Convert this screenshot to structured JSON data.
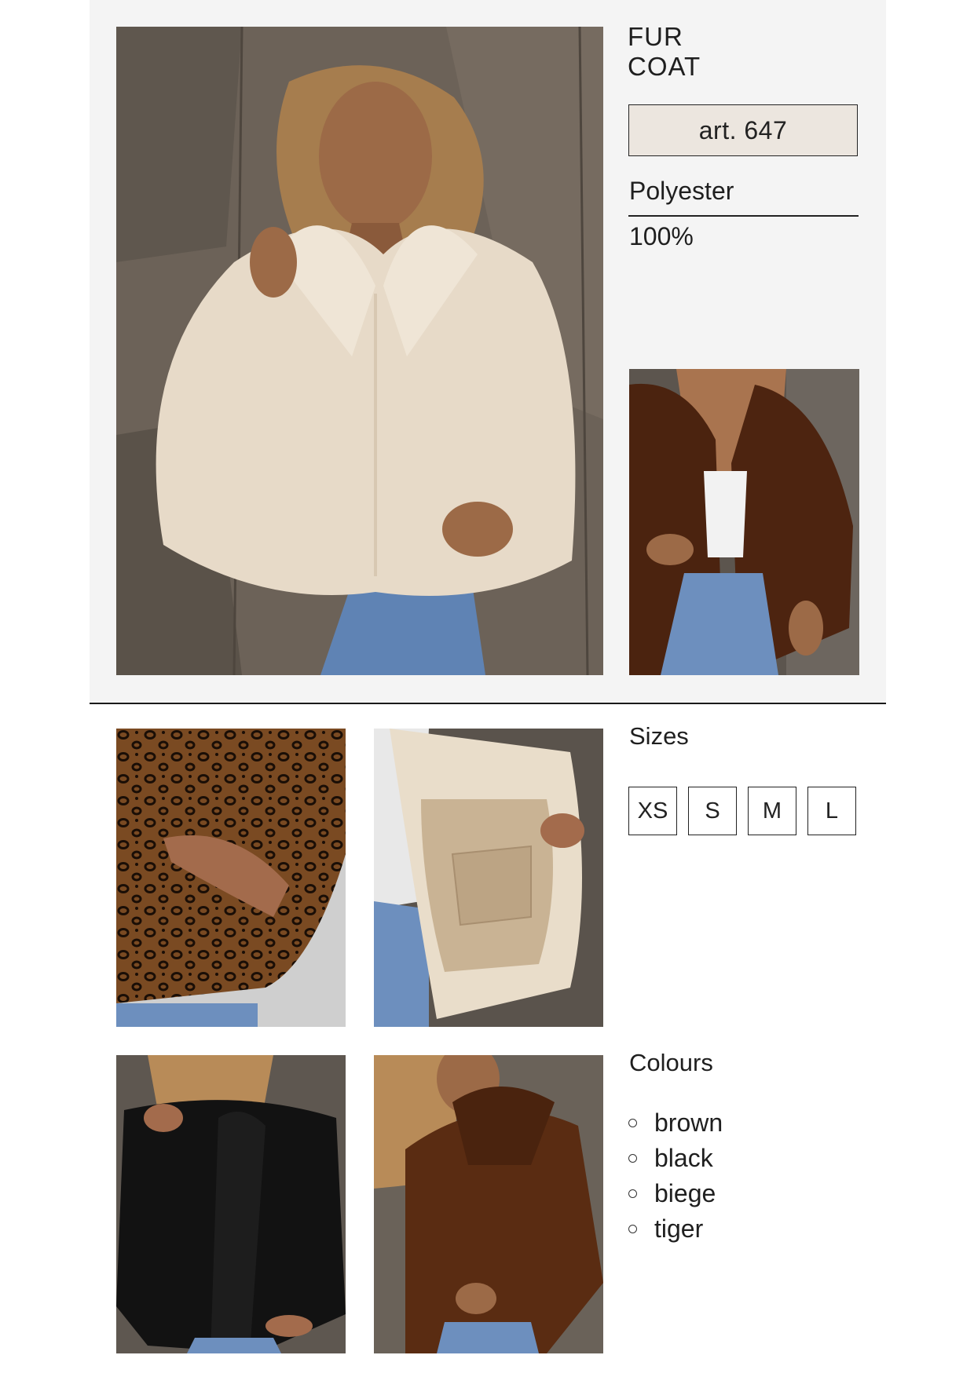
{
  "product": {
    "title_line1": "FUR",
    "title_line2": "COAT",
    "article": "art. 647",
    "material": {
      "name": "Polyester",
      "percent": "100%"
    }
  },
  "sizes": {
    "label": "Sizes",
    "options": [
      "XS",
      "S",
      "M",
      "L"
    ]
  },
  "colours": {
    "label": "Colours",
    "options": [
      "brown",
      "black",
      "biege",
      "tiger"
    ]
  },
  "colors": {
    "panel_bg": "#f4f4f4",
    "article_bg": "#ece6df",
    "text": "#1f1f1f",
    "fur_beige": "#e9dccb",
    "fur_brown": "#5a2c12",
    "fur_black": "#111111",
    "denim": "#6f93c2",
    "wall": "#6a6158"
  },
  "images": [
    {
      "name": "main-photo-beige-fur-coat"
    },
    {
      "name": "side-photo-brown-fur-coat"
    },
    {
      "name": "gallery-photo-tiger-print"
    },
    {
      "name": "gallery-photo-beige-lining"
    },
    {
      "name": "gallery-photo-black-fur-coat"
    },
    {
      "name": "gallery-photo-brown-fur-coat"
    }
  ]
}
